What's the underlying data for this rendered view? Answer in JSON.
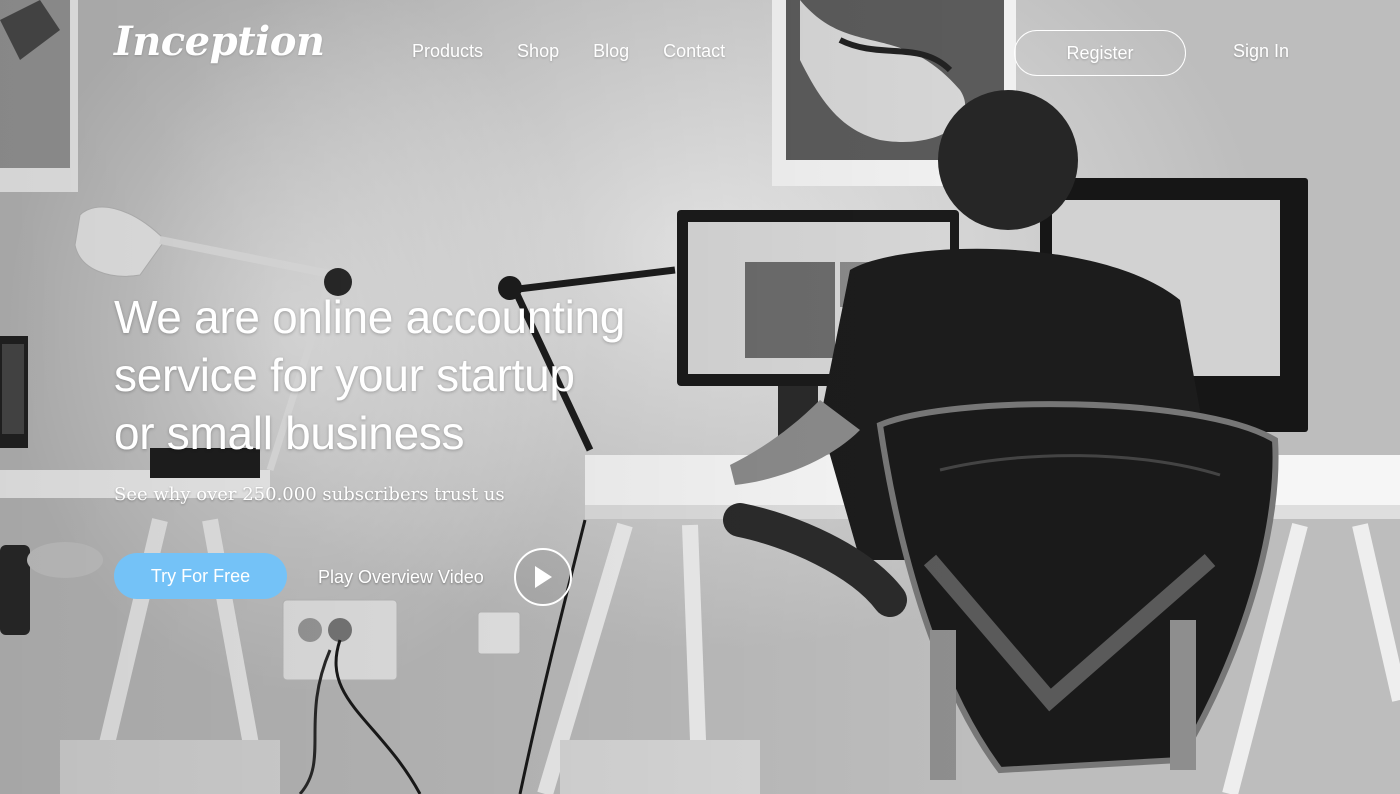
{
  "brand": {
    "logo_text": "Inception"
  },
  "nav": {
    "items": [
      {
        "label": "Products"
      },
      {
        "label": "Shop"
      },
      {
        "label": "Blog"
      },
      {
        "label": "Contact"
      }
    ]
  },
  "header_actions": {
    "register_label": "Register",
    "signin_label": "Sign In"
  },
  "hero": {
    "headline_lines": [
      "We are online accounting",
      "service for your startup",
      "or small business"
    ],
    "subhead": "See why over 250.000 subscribers trust us",
    "cta_label": "Try For Free",
    "video_label": "Play Overview Video",
    "play_icon": "play-icon"
  },
  "colors": {
    "accent": "#74c2f7",
    "text": "#ffffff"
  }
}
